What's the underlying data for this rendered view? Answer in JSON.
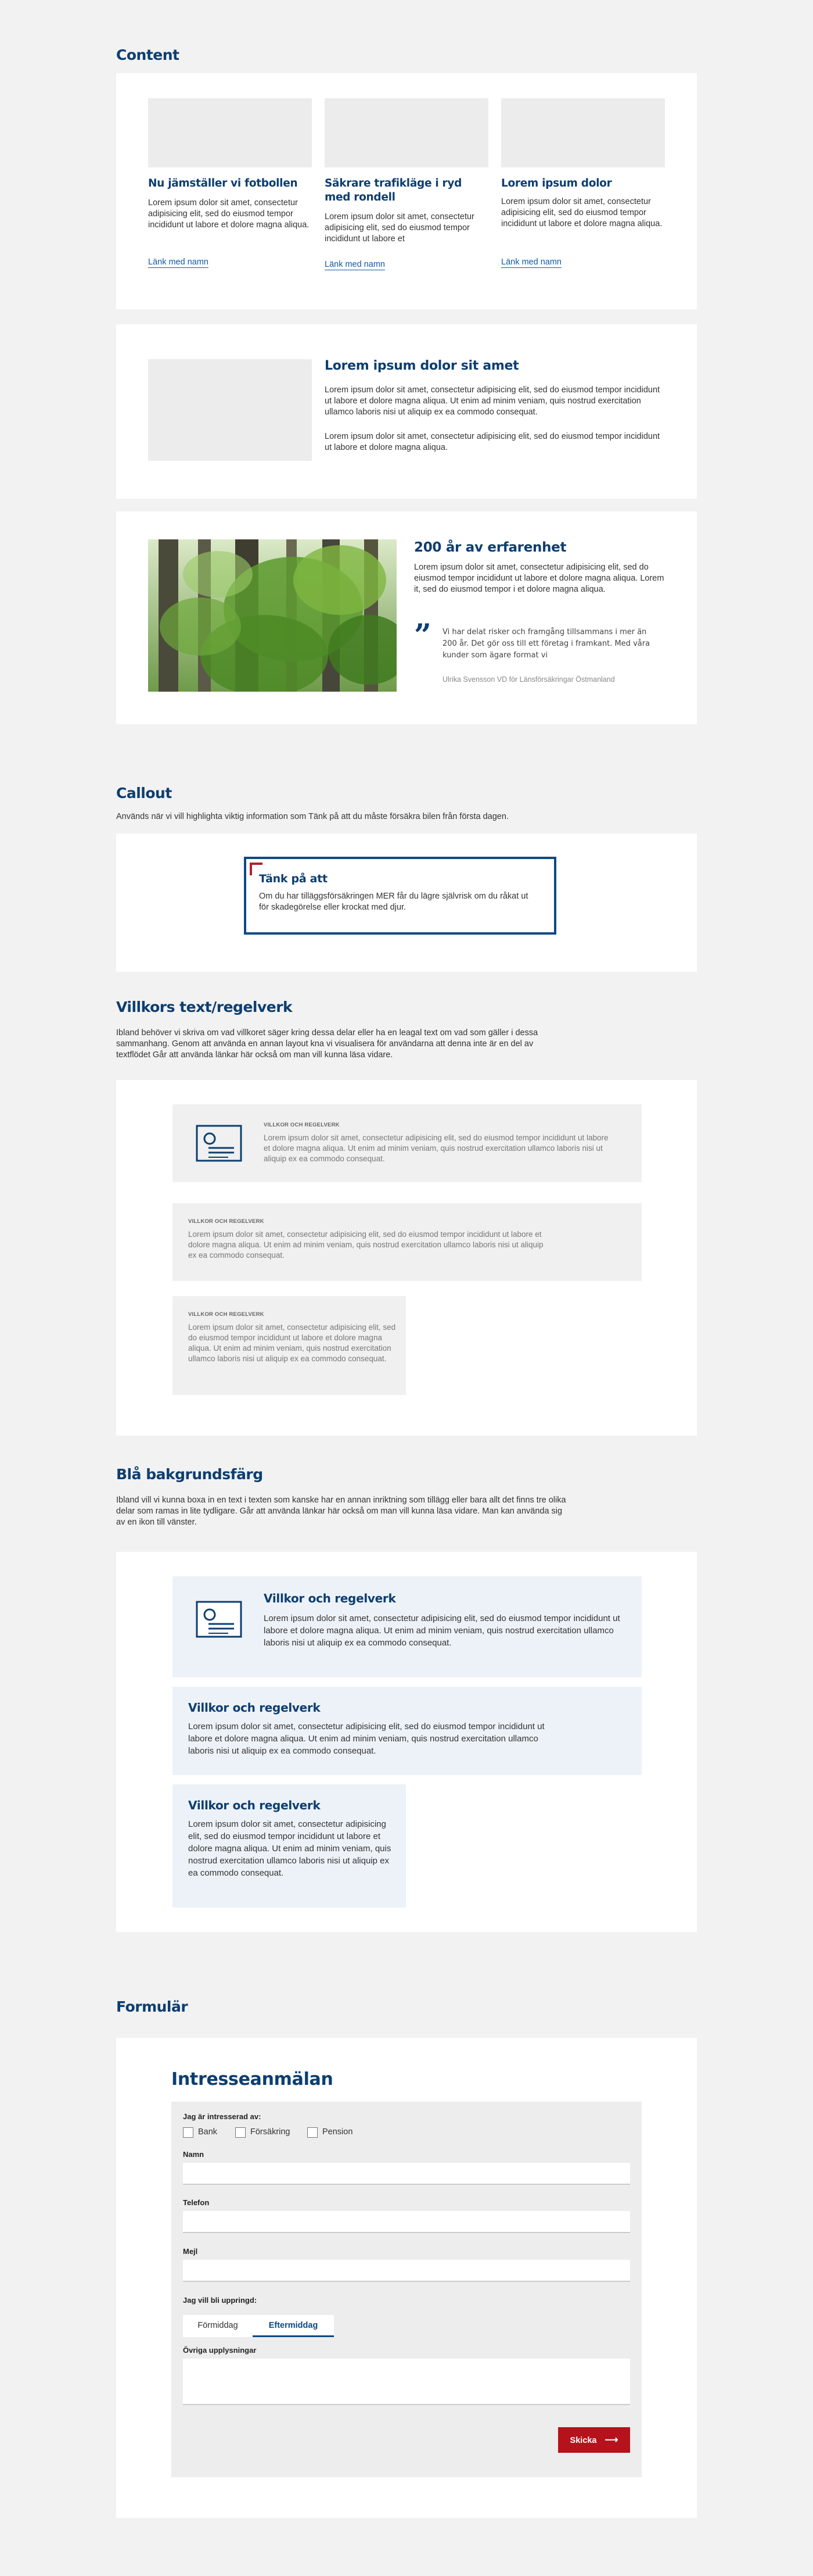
{
  "content_section": {
    "heading": "Content",
    "cards": [
      {
        "title": "Nu jämställer vi fotbollen",
        "text": "Lorem ipsum dolor sit amet, consectetur adipisicing elit, sed do eiusmod tempor incididunt ut labore et dolore magna aliqua.",
        "link": "Länk med namn"
      },
      {
        "title": "Säkrare trafikläge i ryd med rondell",
        "text": "Lorem ipsum dolor sit amet, consectetur adipisicing elit, sed do eiusmod tempor incididunt ut labore et",
        "link": "Länk med namn"
      },
      {
        "title": "Lorem ipsum dolor",
        "text": "Lorem ipsum dolor sit amet, consectetur adipisicing elit, sed do eiusmod tempor incididunt ut labore et dolore magna aliqua.",
        "link": "Länk med namn"
      }
    ],
    "feature": {
      "title": "Lorem ipsum dolor sit amet",
      "p1": "Lorem ipsum dolor sit amet, consectetur adipisicing elit, sed do eiusmod tempor incididunt ut labore et dolore magna aliqua. Ut enim ad minim veniam, quis nostrud exercitation ullamco laboris nisi ut aliquip ex ea commodo consequat.",
      "p2": "Lorem ipsum dolor sit amet, consectetur adipisicing elit, sed do eiusmod tempor incididunt ut labore et dolore magna aliqua."
    },
    "experience": {
      "title": "200 år av erfarenhet",
      "text": "Lorem ipsum dolor sit amet, consectetur adipisicing elit, sed do eiusmod tempor incididunt ut labore et dolore magna aliqua. Lorem it, sed do eiusmod tempor i et dolore magna aliqua.",
      "quote": "Vi har delat risker och framgång tillsammans i mer än 200 år. Det gör oss till ett företag i framkant. Med våra kunder som ägare  format vi",
      "author": "Ulrika Svensson VD för Länsförsäkringar Östmanland"
    }
  },
  "callout_section": {
    "heading": "Callout",
    "intro": "Används när vi vill highlighta viktig information som  Tänk på att du måste försäkra bilen från första dagen.",
    "box_title": "Tänk på att",
    "box_text": "Om du har tilläggsförsäkringen MER får du lägre självrisk om du råkat ut för skadegörelse eller krockat med djur."
  },
  "terms_section": {
    "heading": "Villkors text/regelverk",
    "intro": "Ibland behöver vi skriva om vad villkoret säger kring dessa delar eller ha en leagal text om vad som gäller i dessa sammanhang. Genom att använda en annan layout kna vi visualisera för användarna att denna inte är en del av textflödet Går att använda länkar här också om man vill kunna läsa vidare.",
    "items": [
      {
        "cap": "VILLKOR OCH REGELVERK",
        "text": "Lorem ipsum dolor sit amet, consectetur adipisicing elit, sed do eiusmod tempor incididunt ut labore et dolore magna aliqua. Ut enim ad minim veniam, quis nostrud exercitation ullamco laboris nisi ut aliquip ex ea commodo consequat.",
        "icon": "document-icon"
      },
      {
        "cap": "VILLKOR OCH REGELVERK",
        "text": "Lorem ipsum dolor sit amet, consectetur adipisicing elit, sed do eiusmod tempor incididunt ut labore et dolore magna aliqua. Ut enim ad minim veniam, quis nostrud exercitation ullamco laboris nisi ut aliquip ex ea commodo consequat."
      },
      {
        "cap": "VILLKOR OCH REGELVERK",
        "text": "Lorem ipsum dolor sit amet, consectetur adipisicing elit, sed do eiusmod tempor incididunt ut labore et dolore magna aliqua. Ut enim ad minim veniam, quis nostrud exercitation ullamco laboris nisi ut aliquip ex ea commodo consequat."
      }
    ]
  },
  "blue_section": {
    "heading": "Blå bakgrundsfärg",
    "intro": "Ibland vill vi kunna boxa in en text i texten som kanske har en annan inriktning som tillägg eller bara allt det finns tre olika delar som ramas in lite tydligare. Går att använda länkar här också om man vill kunna läsa vidare. Man kan använda sig av en ikon till vänster.",
    "items": [
      {
        "title": "Villkor och regelverk",
        "text": "Lorem ipsum dolor sit amet, consectetur adipisicing elit, sed do eiusmod tempor incididunt ut labore et dolore magna aliqua. Ut enim ad minim veniam, quis nostrud exercitation ullamco laboris nisi ut aliquip ex ea commodo consequat.",
        "icon": "document-icon"
      },
      {
        "title": "Villkor och regelverk",
        "text": "Lorem ipsum dolor sit amet, consectetur adipisicing elit, sed do eiusmod tempor incididunt ut labore et dolore magna aliqua. Ut enim ad minim veniam, quis nostrud exercitation ullamco laboris nisi ut aliquip ex ea commodo consequat."
      },
      {
        "title": "Villkor och regelverk",
        "text": "Lorem ipsum dolor sit amet, consectetur adipisicing elit, sed do eiusmod tempor incididunt ut labore et dolore magna aliqua. Ut enim ad minim veniam, quis nostrud exercitation ullamco laboris nisi ut aliquip ex ea commodo consequat."
      }
    ]
  },
  "form_section": {
    "heading": "Formulär",
    "form_title": "Intresseanmälan",
    "interest_label": "Jag är intresserad av:",
    "options": [
      "Bank",
      "Försäkring",
      "Pension"
    ],
    "name_label": "Namn",
    "phone_label": "Telefon",
    "email_label": "Mejl",
    "callback_label": "Jag vill bli uppringd:",
    "tabs": [
      "Förmiddag",
      "Eftermiddag"
    ],
    "selected_tab": "Eftermiddag",
    "other_label": "Övriga upplysningar",
    "submit_label": "Skicka"
  },
  "colors": {
    "brand_blue": "#0d3e70",
    "accent_red": "#b5121b",
    "link_blue": "#0f5aa8"
  }
}
